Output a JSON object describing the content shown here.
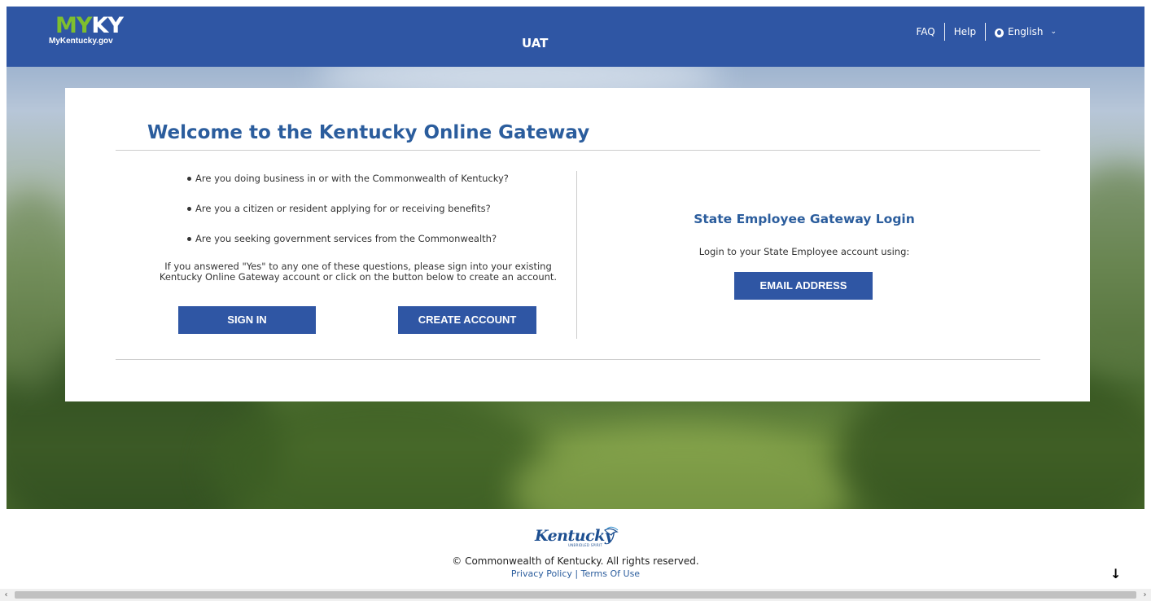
{
  "header": {
    "logo_my": "MY",
    "logo_ky": "KY",
    "logo_sub": "MyKentucky.gov",
    "env_label": "UAT",
    "nav": {
      "faq": "FAQ",
      "help": "Help",
      "language": "English"
    }
  },
  "welcome": {
    "title": "Welcome to the Kentucky Online Gateway",
    "questions": [
      "Are you doing business in or with the Commonwealth of Kentucky?",
      "Are you a citizen or resident applying for or receiving benefits?",
      "Are you seeking government services from the Commonwealth?"
    ],
    "answer_line1": "If you answered \"Yes\" to any one of these questions, please sign into your existing",
    "answer_line2": "Kentucky Online Gateway account or click on the button below to create an account.",
    "sign_in": "SIGN IN",
    "create_account": "CREATE ACCOUNT"
  },
  "state_employee": {
    "title": "State Employee Gateway Login",
    "subtitle": "Login to your State Employee account using:",
    "email_button": "EMAIL ADDRESS"
  },
  "footer": {
    "ky_logo_text": "Kentucky",
    "ky_logo_tag": "UNBRIDLED SPIRIT",
    "copyright": "© Commonwealth of Kentucky. All rights reserved.",
    "privacy": "Privacy Policy",
    "separator": "|",
    "terms": "Terms Of Use"
  },
  "icons": {
    "globe": "globe-icon",
    "caret": "chevron-down-icon",
    "scroll_down": "arrow-down-icon"
  },
  "colors": {
    "header_bg": "#2f56a4",
    "title_blue": "#2b5d9d",
    "button_bg": "#2f56a4",
    "logo_green": "#7fbf2e"
  }
}
